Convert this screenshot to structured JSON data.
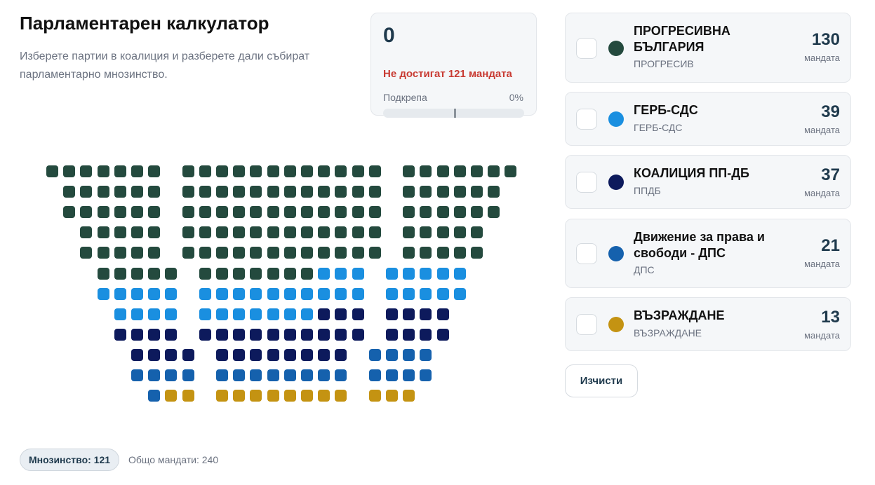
{
  "header": {
    "title": "Парламентарен калкулатор",
    "subtitle": "Изберете партии в коалиция и разберете дали събират парламентарно мнозинство."
  },
  "stats": {
    "selected_seats": "0",
    "status_text": "Не достигат 121 мандата",
    "support_label": "Подкрепа",
    "support_percent": "0%",
    "support_fraction": 0,
    "majority_marker_fraction": 0.504,
    "status_color": "#c83a32"
  },
  "parties": [
    {
      "name": "ПРОГРЕСИВНА БЪЛГАРИЯ",
      "short": "ПРОГРЕСИВ",
      "seats": "130",
      "seats_label": "мандата",
      "color": "#244a3e",
      "selected": false
    },
    {
      "name": "ГЕРБ-СДС",
      "short": "ГЕРБ-СДС",
      "seats": "39",
      "seats_label": "мандата",
      "color": "#1a8fe0",
      "selected": false
    },
    {
      "name": "КОАЛИЦИЯ ПП-ДБ",
      "short": "ППДБ",
      "seats": "37",
      "seats_label": "мандата",
      "color": "#0d1a5c",
      "selected": false
    },
    {
      "name": "Движение за права и свободи - ДПС",
      "short": "ДПС",
      "seats": "21",
      "seats_label": "мандата",
      "color": "#1561ad",
      "selected": false
    },
    {
      "name": "ВЪЗРАЖДАНЕ",
      "short": "ВЪЗРАЖДАНЕ",
      "seats": "13",
      "seats_label": "мандата",
      "color": "#c49312",
      "selected": false
    }
  ],
  "actions": {
    "clear_label": "Изчисти"
  },
  "footer": {
    "majority_label": "Мнозинство: 121",
    "total_label": "Общо мандати:",
    "total_value": "240"
  }
}
